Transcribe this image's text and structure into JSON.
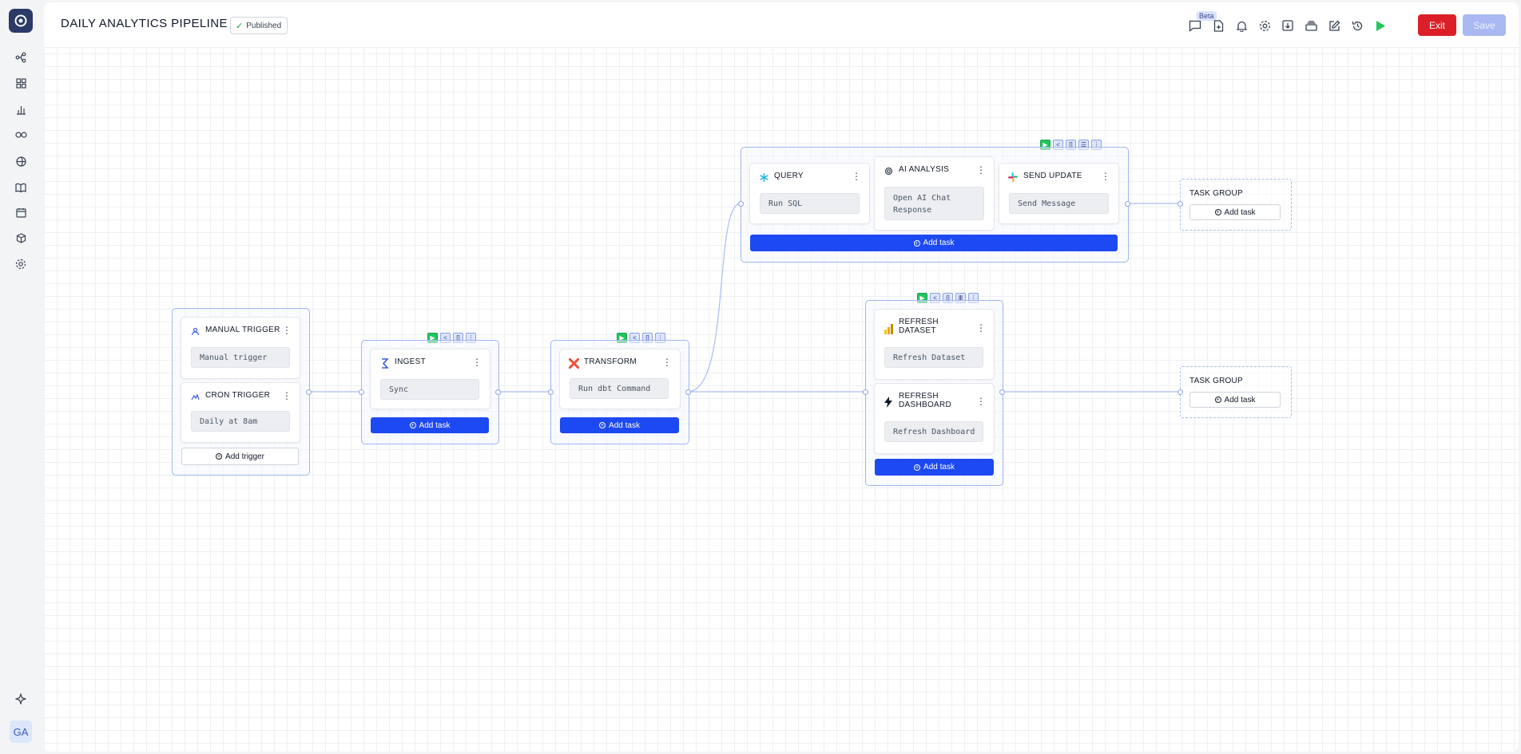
{
  "app": {
    "title": "DAILY ANALYTICS PIPELINE",
    "status": "Published",
    "beta_label": "Beta",
    "exit_label": "Exit",
    "save_label": "Save",
    "user_initials": "GA"
  },
  "rail": {
    "icons": [
      "flow-icon",
      "grid-icon",
      "bar-chart-icon",
      "link-icon",
      "globe-icon",
      "book-icon",
      "calendar-icon",
      "cube-icon",
      "settings-icon"
    ],
    "bottom_icon": "sparkle-icon"
  },
  "header_icons": [
    "chat-icon",
    "file-add-icon",
    "bell-icon",
    "gear-icon",
    "download-icon",
    "layers-icon",
    "edit-icon",
    "history-icon",
    "run-icon"
  ],
  "nodes": {
    "triggers": {
      "manual": {
        "title": "MANUAL TRIGGER",
        "chip": "Manual trigger"
      },
      "cron": {
        "title": "CRON TRIGGER",
        "chip": "Daily at 8am"
      },
      "add_label": "Add trigger"
    },
    "ingest": {
      "title": "INGEST",
      "chip": "Sync",
      "add_label": "Add task"
    },
    "transform": {
      "title": "TRANSFORM",
      "chip": "Run dbt Command",
      "add_label": "Add task"
    },
    "query": {
      "title": "QUERY",
      "chip": "Run SQL"
    },
    "ai": {
      "title": "AI ANALYSIS",
      "chip": "Open AI Chat Response"
    },
    "send": {
      "title": "SEND UPDATE",
      "chip": "Send Message"
    },
    "top_add_label": "Add task",
    "refresh_dataset": {
      "title": "REFRESH DATASET",
      "chip": "Refresh Dataset"
    },
    "refresh_dashboard": {
      "title": "REFRESH DASHBOARD",
      "chip": "Refresh Dashboard"
    },
    "refresh_add_label": "Add task",
    "task_group_top": {
      "label": "TASK GROUP",
      "add_label": "Add task"
    },
    "task_group_bottom": {
      "label": "TASK GROUP",
      "add_label": "Add task"
    }
  },
  "colors": {
    "accent": "#1d49f2",
    "exit": "#dc1f26",
    "save_disabled": "#a9b8f2",
    "group_border": "#9db5ee",
    "run": "#22c55e"
  }
}
